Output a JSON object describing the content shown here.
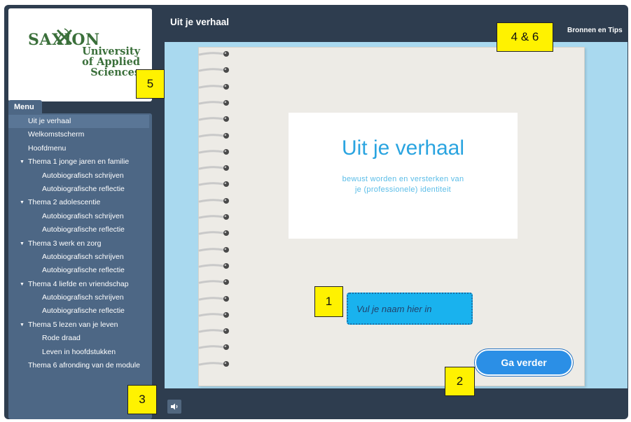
{
  "header": {
    "title": "Uit je verhaal",
    "resources_link": "Bronnen en Tips"
  },
  "logo": {
    "brand": "SAXION",
    "lines": [
      "University",
      "of Applied",
      "Sciences"
    ],
    "brand_color": "#3a6f3a"
  },
  "sidebar": {
    "tab_label": "Menu",
    "items": [
      {
        "label": "Uit je verhaal",
        "level": 0,
        "current": true
      },
      {
        "label": "Welkomstscherm",
        "level": 1
      },
      {
        "label": "Hoofdmenu",
        "level": 1
      },
      {
        "label": "Thema 1 jonge jaren en familie",
        "level": 1,
        "expanded": true
      },
      {
        "label": "Autobiografisch schrijven",
        "level": 2
      },
      {
        "label": "Autobiografische reflectie",
        "level": 2
      },
      {
        "label": "Thema 2 adolescentie",
        "level": 1,
        "expanded": true
      },
      {
        "label": "Autobiografisch schrijven",
        "level": 2
      },
      {
        "label": "Autobiografische reflectie",
        "level": 2
      },
      {
        "label": "Thema 3 werk en zorg",
        "level": 1,
        "expanded": true
      },
      {
        "label": "Autobiografisch schrijven",
        "level": 2
      },
      {
        "label": "Autobiografische reflectie",
        "level": 2
      },
      {
        "label": "Thema 4 liefde en vriendschap",
        "level": 1,
        "expanded": true
      },
      {
        "label": "Autobiografisch schrijven",
        "level": 2
      },
      {
        "label": "Autobiografische reflectie",
        "level": 2
      },
      {
        "label": "Thema 5 lezen van je leven",
        "level": 1,
        "expanded": true
      },
      {
        "label": "Rode draad",
        "level": 2
      },
      {
        "label": "Leven in hoofdstukken",
        "level": 2
      },
      {
        "label": "Thema 6 afronding van de module",
        "level": 1
      }
    ]
  },
  "card": {
    "title": "Uit je verhaal",
    "subtitle_line1": "bewust worden en versterken van",
    "subtitle_line2": "je (professionele) identiteit"
  },
  "name_input": {
    "placeholder": "Vul je naam hier in",
    "value": ""
  },
  "continue_button": {
    "label": "Ga verder"
  },
  "callouts": {
    "c1": "1",
    "c2": "2",
    "c3": "3",
    "c4": "4 & 6",
    "c5": "5"
  },
  "colors": {
    "frame": "#2e3d4f",
    "menu_panel": "#4d6785",
    "stage": "#a9d9ef",
    "accent_title": "#2aa4e0",
    "input": "#19b2ee",
    "button": "#2b8fe6",
    "callout": "#fff200"
  },
  "icons": {
    "audio": "speaker-icon",
    "expand": "triangle-down-icon",
    "binding": "spiral-ring-icon"
  }
}
